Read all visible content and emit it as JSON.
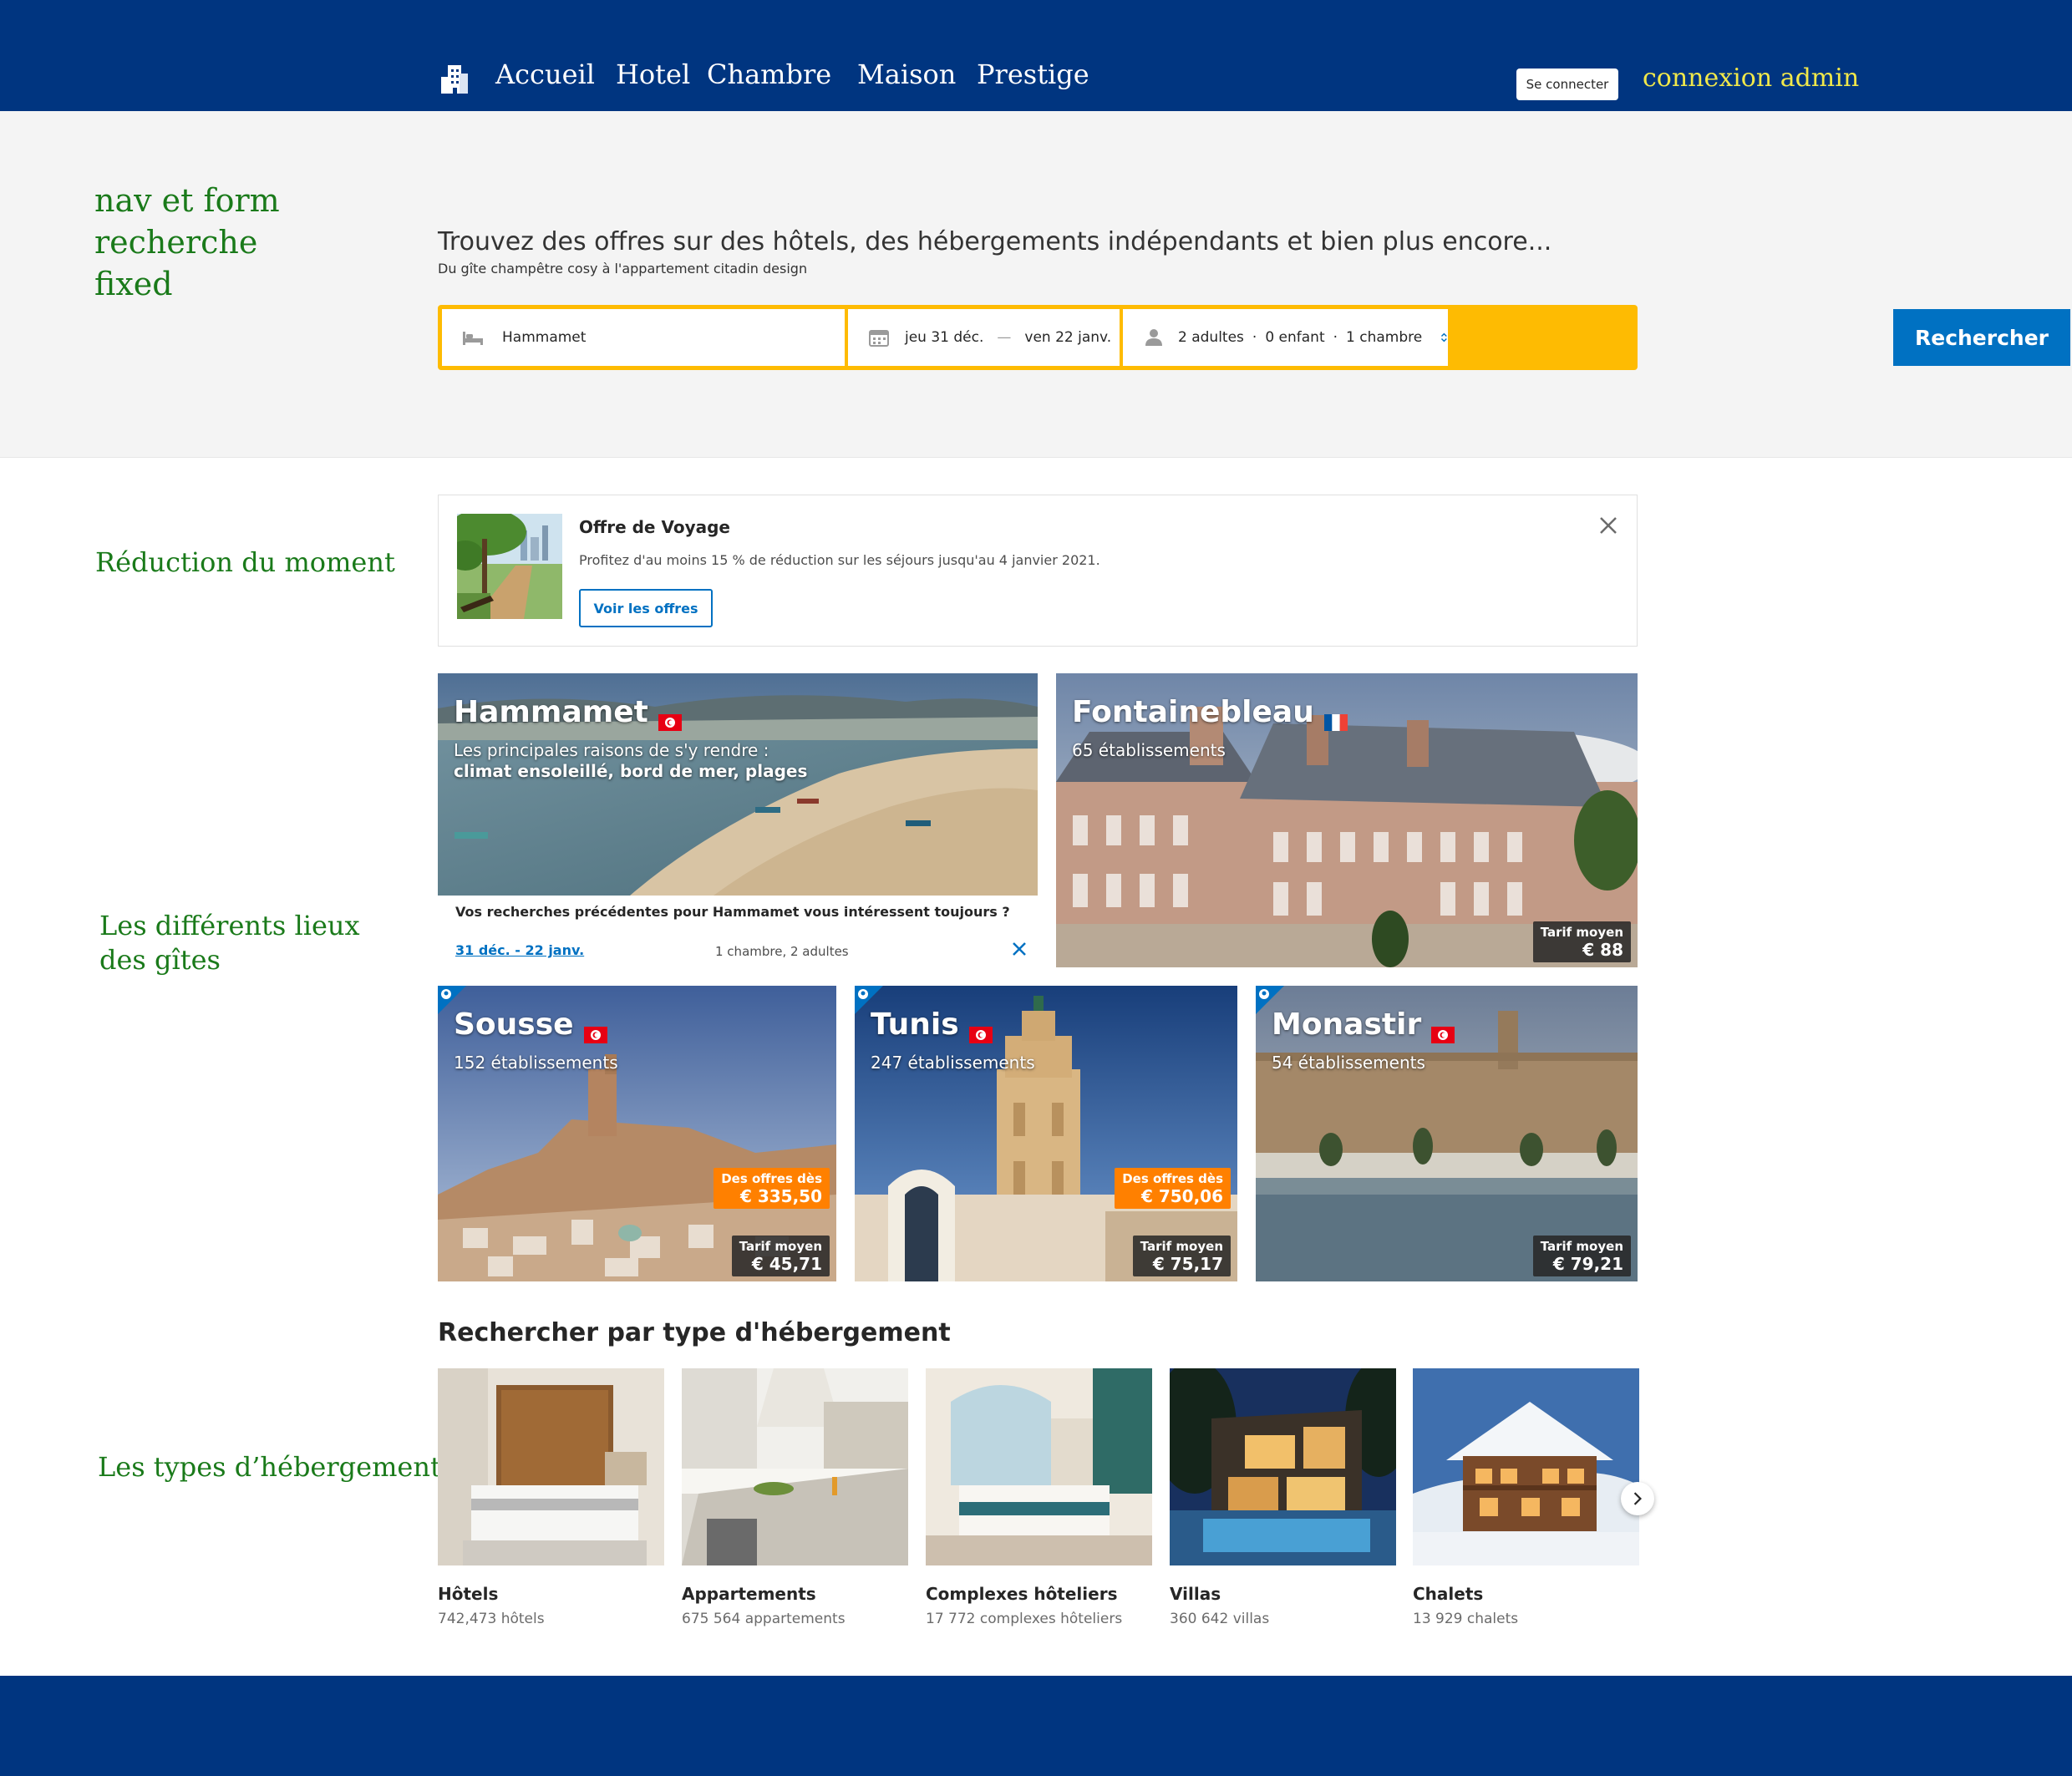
{
  "nav": {
    "links": [
      "Accueil",
      "Hotel",
      "Chambre",
      "Maison",
      "Prestige"
    ],
    "login_label": "Se connecter",
    "admin_label": "connexion admin"
  },
  "annotations": {
    "nav_line1": "nav et form",
    "nav_line2": "recherche",
    "nav_line3": "fixed",
    "promo": "Réduction du moment",
    "places_line1": "Les différents lieux",
    "places_line2": "des gîtes",
    "types": "Les types d’hébergement"
  },
  "hero": {
    "title": "Trouvez des offres sur des hôtels, des hébergements indépendants et bien plus encore...",
    "subtitle": "Du gîte champêtre cosy à l'appartement citadin design"
  },
  "search": {
    "destination": "Hammamet",
    "checkin": "jeu 31 déc.",
    "date_separator": "—",
    "checkout": "ven 22 janv.",
    "adults": "2 adultes",
    "children": "0 enfant",
    "rooms": "1 chambre",
    "dot": "·",
    "submit_label": "Rechercher"
  },
  "promo": {
    "title": "Offre de Voyage",
    "text": "Profitez d'au moins 15 % de réduction sur les séjours jusqu'au 4 janvier 2021.",
    "button_label": "Voir les offres"
  },
  "destinations": {
    "hammamet": {
      "name": "Hammamet",
      "line1": "Les principales raisons de s'y rendre :",
      "line2": "climat ensoleillé, bord de mer, plages"
    },
    "recent": {
      "question": "Vos recherches précédentes pour Hammamet vous intéressent toujours ?",
      "dates": "31 déc. - 22 janv.",
      "guests": "1 chambre, 2 adultes"
    },
    "fontainebleau": {
      "name": "Fontainebleau",
      "count": "65 établissements",
      "avg_label": "Tarif moyen",
      "avg_price": "€ 88"
    },
    "sousse": {
      "name": "Sousse",
      "count": "152 établissements",
      "offer_label": "Des offres dès",
      "offer_price": "€ 335,50",
      "avg_label": "Tarif moyen",
      "avg_price": "€ 45,71"
    },
    "tunis": {
      "name": "Tunis",
      "count": "247 établissements",
      "offer_label": "Des offres dès",
      "offer_price": "€ 750,06",
      "avg_label": "Tarif moyen",
      "avg_price": "€ 75,17"
    },
    "monastir": {
      "name": "Monastir",
      "count": "54 établissements",
      "avg_label": "Tarif moyen",
      "avg_price": "€ 79,21"
    }
  },
  "property_types": {
    "title": "Rechercher par type d'hébergement",
    "items": [
      {
        "name": "Hôtels",
        "count": "742,473 hôtels"
      },
      {
        "name": "Appartements",
        "count": "675 564 appartements"
      },
      {
        "name": "Complexes hôteliers",
        "count": "17 772 complexes hôteliers"
      },
      {
        "name": "Villas",
        "count": "360 642 villas"
      },
      {
        "name": "Chalets",
        "count": "13 929 chalets"
      }
    ]
  },
  "colors": {
    "brand_blue": "#003580",
    "accent_blue": "#0071c2",
    "search_border": "#febb02",
    "offer_orange": "#ff8000",
    "admin_yellow": "#f1e84a",
    "annotation_green": "#1a7a1a"
  }
}
